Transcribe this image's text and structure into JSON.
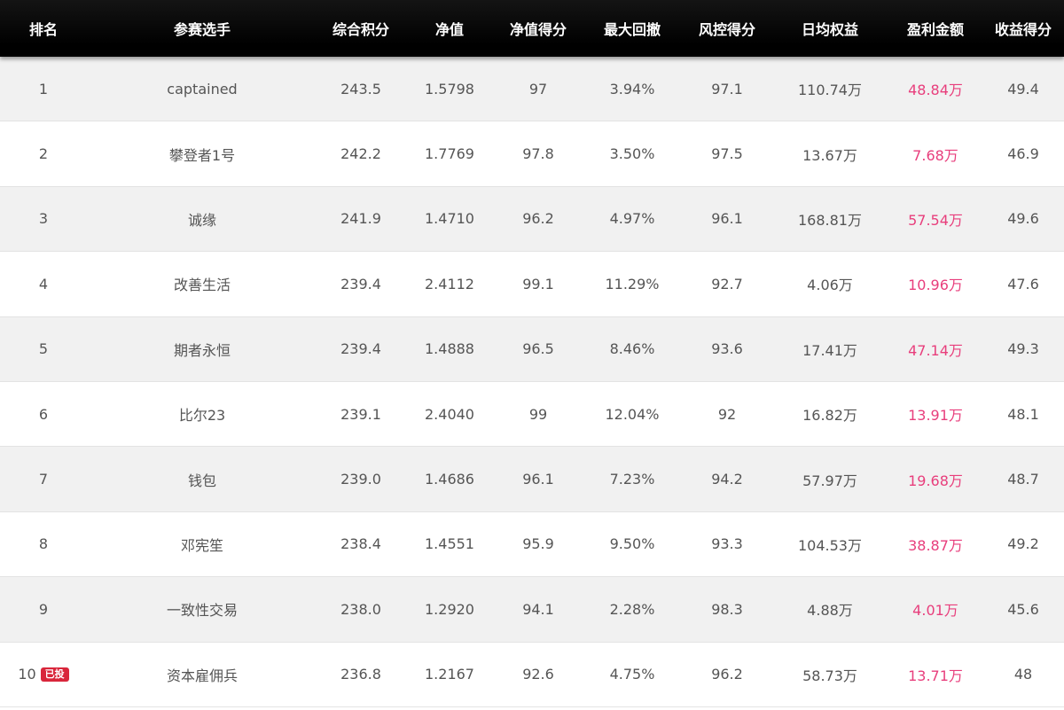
{
  "headers": [
    "排名",
    "参赛选手",
    "综合积分",
    "净值",
    "净值得分",
    "最大回撤",
    "风控得分",
    "日均权益",
    "盈利金额",
    "收益得分"
  ],
  "rows": [
    {
      "rank": "1",
      "badge": "",
      "player": "captained",
      "score": "243.5",
      "nav": "1.5798",
      "nav_score": "97",
      "drawdown": "3.94%",
      "risk_score": "97.1",
      "daily_equity": "110.74万",
      "profit": "48.84万",
      "return_score": "49.4"
    },
    {
      "rank": "2",
      "badge": "",
      "player": "攀登者1号",
      "score": "242.2",
      "nav": "1.7769",
      "nav_score": "97.8",
      "drawdown": "3.50%",
      "risk_score": "97.5",
      "daily_equity": "13.67万",
      "profit": "7.68万",
      "return_score": "46.9"
    },
    {
      "rank": "3",
      "badge": "",
      "player": "诚缘",
      "score": "241.9",
      "nav": "1.4710",
      "nav_score": "96.2",
      "drawdown": "4.97%",
      "risk_score": "96.1",
      "daily_equity": "168.81万",
      "profit": "57.54万",
      "return_score": "49.6"
    },
    {
      "rank": "4",
      "badge": "",
      "player": "改善生活",
      "score": "239.4",
      "nav": "2.4112",
      "nav_score": "99.1",
      "drawdown": "11.29%",
      "risk_score": "92.7",
      "daily_equity": "4.06万",
      "profit": "10.96万",
      "return_score": "47.6"
    },
    {
      "rank": "5",
      "badge": "",
      "player": "期者永恒",
      "score": "239.4",
      "nav": "1.4888",
      "nav_score": "96.5",
      "drawdown": "8.46%",
      "risk_score": "93.6",
      "daily_equity": "17.41万",
      "profit": "47.14万",
      "return_score": "49.3"
    },
    {
      "rank": "6",
      "badge": "",
      "player": "比尔23",
      "score": "239.1",
      "nav": "2.4040",
      "nav_score": "99",
      "drawdown": "12.04%",
      "risk_score": "92",
      "daily_equity": "16.82万",
      "profit": "13.91万",
      "return_score": "48.1"
    },
    {
      "rank": "7",
      "badge": "",
      "player": "钱包",
      "score": "239.0",
      "nav": "1.4686",
      "nav_score": "96.1",
      "drawdown": "7.23%",
      "risk_score": "94.2",
      "daily_equity": "57.97万",
      "profit": "19.68万",
      "return_score": "48.7"
    },
    {
      "rank": "8",
      "badge": "",
      "player": "邓宪笙",
      "score": "238.4",
      "nav": "1.4551",
      "nav_score": "95.9",
      "drawdown": "9.50%",
      "risk_score": "93.3",
      "daily_equity": "104.53万",
      "profit": "38.87万",
      "return_score": "49.2"
    },
    {
      "rank": "9",
      "badge": "",
      "player": "一致性交易",
      "score": "238.0",
      "nav": "1.2920",
      "nav_score": "94.1",
      "drawdown": "2.28%",
      "risk_score": "98.3",
      "daily_equity": "4.88万",
      "profit": "4.01万",
      "return_score": "45.6"
    },
    {
      "rank": "10",
      "badge": "已投",
      "player": "资本雇佣兵",
      "score": "236.8",
      "nav": "1.2167",
      "nav_score": "92.6",
      "drawdown": "4.75%",
      "risk_score": "96.2",
      "daily_equity": "58.73万",
      "profit": "13.71万",
      "return_score": "48"
    }
  ],
  "colors": {
    "header_bg": "#000000",
    "header_text": "#ffffff",
    "row_odd_bg": "#f1f1f1",
    "row_even_bg": "#ffffff",
    "profit_text": "#e83e7c",
    "badge_bg": "#d9263b"
  }
}
